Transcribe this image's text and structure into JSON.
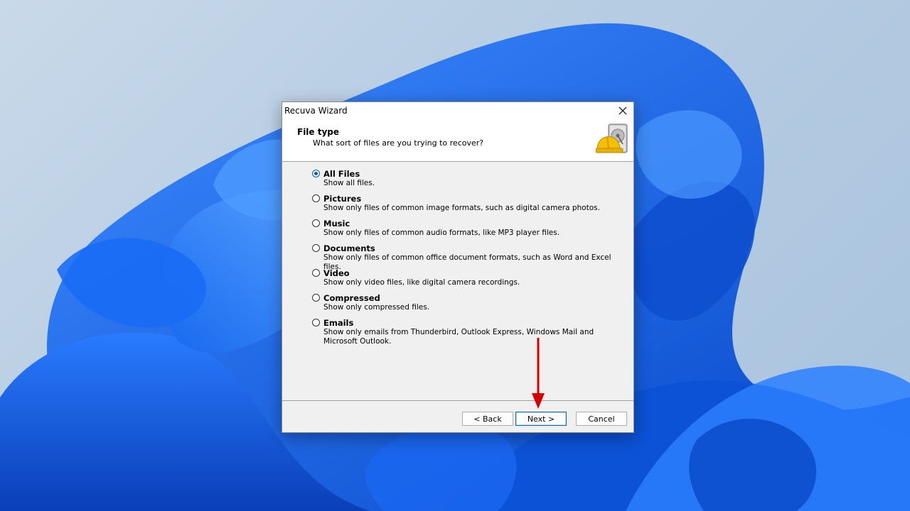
{
  "window": {
    "title": "Recuva Wizard",
    "close_icon": "close-icon"
  },
  "header": {
    "title": "File type",
    "subtitle": "What sort of files are you trying to recover?",
    "icon": "hard-drive-hardhat-icon"
  },
  "options": [
    {
      "label": "All Files",
      "description": "Show all files.",
      "checked": true
    },
    {
      "label": "Pictures",
      "description": "Show only files of common image formats, such as digital camera photos.",
      "checked": false
    },
    {
      "label": "Music",
      "description": "Show only files of common audio formats, like MP3 player files.",
      "checked": false
    },
    {
      "label": "Documents",
      "description": "Show only files of common office document formats, such as Word and Excel files.",
      "checked": false
    },
    {
      "label": "Video",
      "description": "Show only video files, like digital camera recordings.",
      "checked": false
    },
    {
      "label": "Compressed",
      "description": "Show only compressed files.",
      "checked": false
    },
    {
      "label": "Emails",
      "description": "Show only emails from Thunderbird, Outlook Express, Windows Mail and Microsoft Outlook.",
      "checked": false
    }
  ],
  "buttons": {
    "back": "< Back",
    "next": "Next >",
    "cancel": "Cancel"
  },
  "colors": {
    "accent": "#005fb8",
    "annotation_arrow": "#d40000",
    "wallpaper_blue": "#0a5ce8"
  }
}
